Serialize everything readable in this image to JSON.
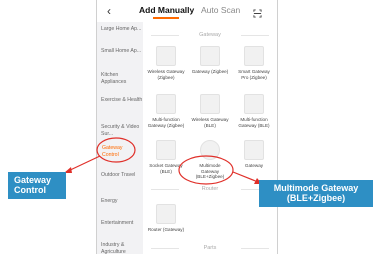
{
  "header": {
    "back_icon": "back-chevron-icon",
    "tab_add_manually": "Add Manually",
    "tab_auto_scan": "Auto Scan",
    "scan_icon": "scan-icon",
    "accent": "#ff6a00"
  },
  "sidebar": {
    "items": [
      {
        "label": "Large Home Ap..."
      },
      {
        "label": "Small Home Ap..."
      },
      {
        "label": "Kitchen Appliances"
      },
      {
        "label": "Exercise & Health"
      },
      {
        "label": "Security & Video Sur..."
      },
      {
        "label": "Gateway Control"
      },
      {
        "label": "Outdoor Travel"
      },
      {
        "label": "Energy"
      },
      {
        "label": "Entertainment"
      },
      {
        "label": "Industry & Agriculture"
      }
    ]
  },
  "sections": {
    "gateway": "Gateway",
    "router": "Router",
    "parts": "Parts"
  },
  "devices": [
    {
      "name": "Wireless Gateway (Zigbee)"
    },
    {
      "name": "Gateway (Zigbee)"
    },
    {
      "name": "Smart Gateway Pro (Zigbee)"
    },
    {
      "name": "Multi-function Gateway (Zigbee)"
    },
    {
      "name": "Wireless Gateway (BLE)"
    },
    {
      "name": "Multi-function Gateway (BLE)"
    },
    {
      "name": "Socket Gateway (BLE)"
    },
    {
      "name": "Multimode Gateway (BLE+Zigbee)"
    },
    {
      "name": "Gateway"
    },
    {
      "name": "Router (Gateway)"
    }
  ],
  "annotations": {
    "left_label_line1": "Gateway",
    "left_label_line2": "Control",
    "right_label_line1": "Multimode Gateway",
    "right_label_line2": "(BLE+Zigbee)",
    "label_color": "#2e8fc4",
    "marker_color": "#e0302a"
  }
}
